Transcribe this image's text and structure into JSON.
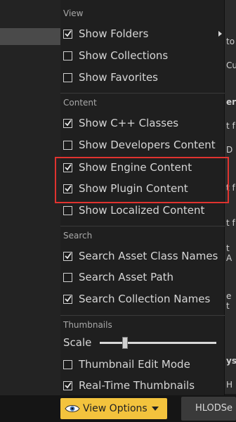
{
  "background_fragments": [
    "to",
    "Cu",
    "eri",
    "t f",
    "D",
    "t f",
    "t f",
    "t A",
    "e t",
    "ys",
    "H"
  ],
  "menu": {
    "view_header": "View",
    "view_items": [
      {
        "label": "Show Folders",
        "checked": true,
        "submenu": true
      },
      {
        "label": "Show Collections",
        "checked": false
      },
      {
        "label": "Show Favorites",
        "checked": false
      }
    ],
    "content_header": "Content",
    "content_items": [
      {
        "label": "Show C++ Classes",
        "checked": true
      },
      {
        "label": "Show Developers Content",
        "checked": false
      },
      {
        "label": "Show Engine Content",
        "checked": true
      },
      {
        "label": "Show Plugin Content",
        "checked": true
      },
      {
        "label": "Show Localized Content",
        "checked": false
      }
    ],
    "search_header": "Search",
    "search_items": [
      {
        "label": "Search Asset Class Names",
        "checked": true
      },
      {
        "label": "Search Asset Path",
        "checked": false
      },
      {
        "label": "Search Collection Names",
        "checked": true
      }
    ],
    "thumbnails_header": "Thumbnails",
    "scale_label": "Scale",
    "scale_value": 0.2,
    "thumbnail_items": [
      {
        "label": "Thumbnail Edit Mode",
        "checked": false
      },
      {
        "label": "Real-Time Thumbnails",
        "checked": true
      }
    ]
  },
  "toolbar": {
    "view_options_label": "View Options",
    "hlod_tab_label": "HLODSe"
  },
  "colors": {
    "view_options_bg": "#f3c33d",
    "highlight_border": "#e0332f",
    "menu_bg": "#1f1f1f"
  }
}
